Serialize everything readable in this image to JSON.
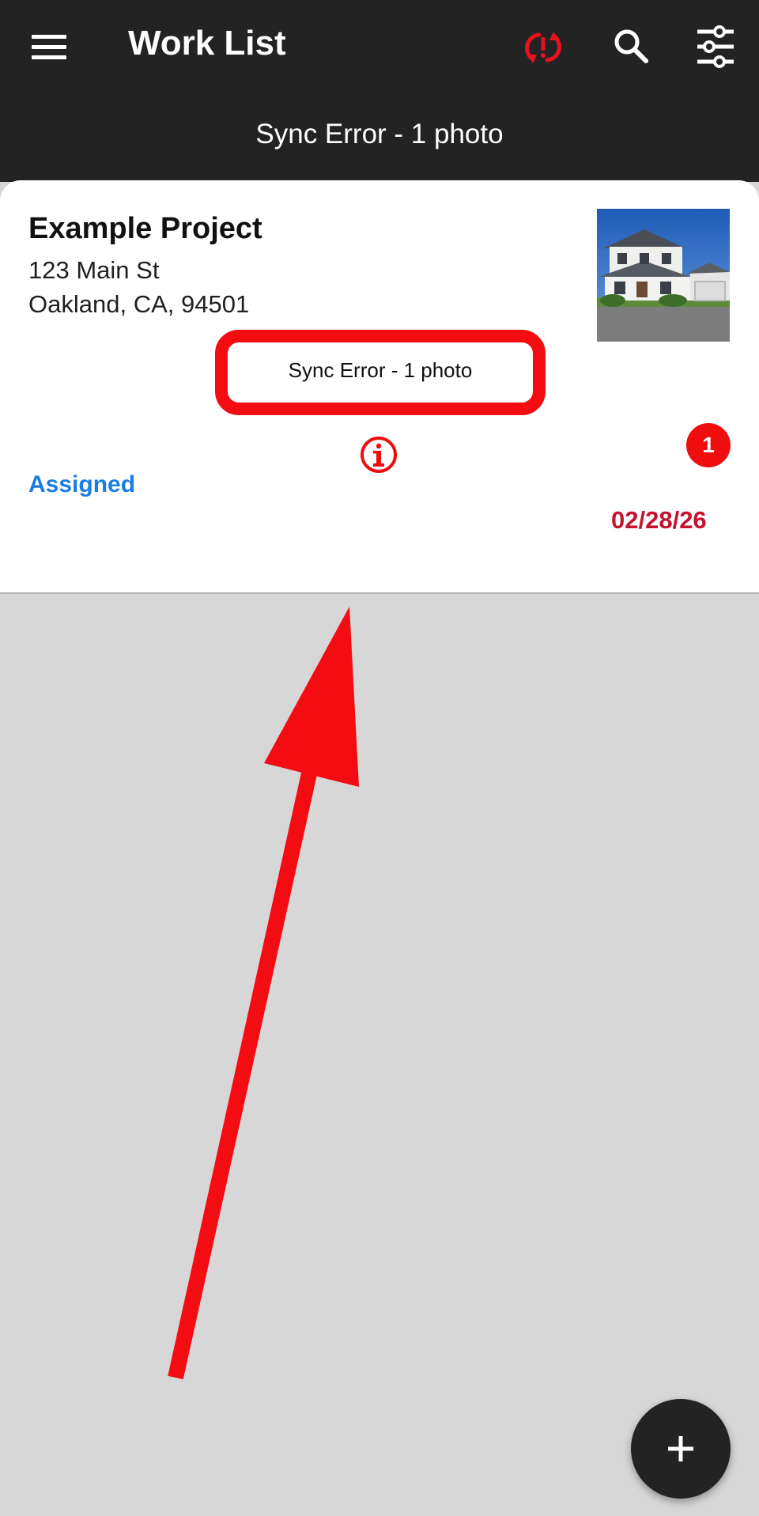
{
  "appbar": {
    "title": "Work List",
    "banner": "Sync Error - 1 photo",
    "icons": [
      "menu-icon",
      "sync-error-icon",
      "search-icon",
      "filter-sliders-icon"
    ]
  },
  "project_card": {
    "title": "Example Project",
    "address_line1": "123 Main St",
    "address_line2": "Oakland, CA, 94501",
    "status": "Assigned",
    "badge_count": "1",
    "date": "02/28/26",
    "sync_message": "Sync Error - 1 photo"
  },
  "colors": {
    "appbar_bg": "#232323",
    "content_bg": "#d7d7d8",
    "accent_blue": "#1a7de3",
    "error_red": "#ef0d0d",
    "date_red": "#c4122f"
  },
  "fab": {
    "icon": "plus-icon"
  }
}
